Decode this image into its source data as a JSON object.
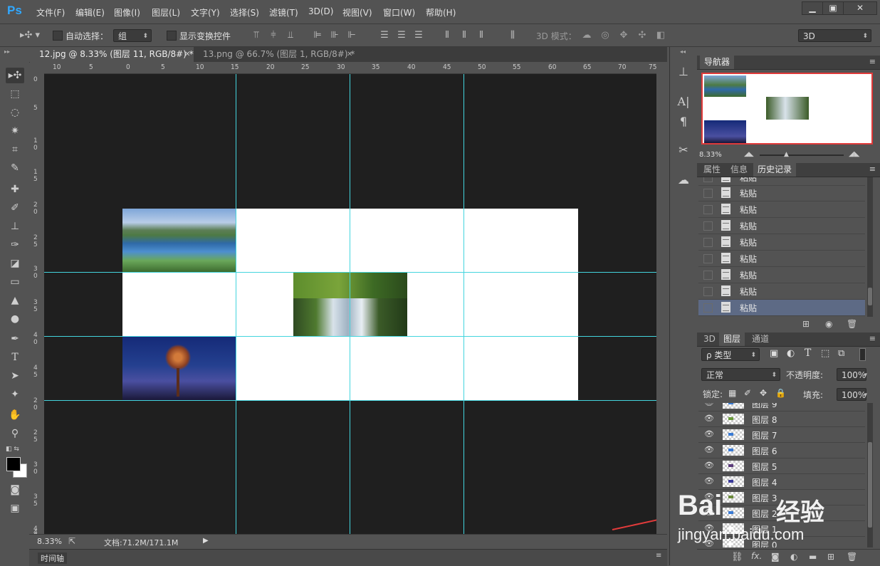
{
  "app": {
    "logo": "Ps"
  },
  "menu": [
    "文件(F)",
    "编辑(E)",
    "图像(I)",
    "图层(L)",
    "文字(Y)",
    "选择(S)",
    "滤镜(T)",
    "3D(D)",
    "视图(V)",
    "窗口(W)",
    "帮助(H)"
  ],
  "options": {
    "auto_select_label": "自动选择：",
    "auto_select_value": "组",
    "show_transform_label": "显示变换控件",
    "mode_3d_label": "3D 模式：",
    "workspace_value": "3D"
  },
  "tabs": [
    {
      "label": "12.jpg @ 8.33% (图层 11, RGB/8#) *",
      "active": true
    },
    {
      "label": "13.png @ 66.7% (图层 1, RGB/8#) *",
      "active": false
    }
  ],
  "ruler_top": [
    "10",
    "5",
    "0",
    "5",
    "10",
    "15",
    "20",
    "25",
    "30",
    "35",
    "40",
    "45",
    "50",
    "55",
    "60",
    "65",
    "70",
    "75"
  ],
  "ruler_left": [
    "0",
    "5",
    "1 0",
    "1 5",
    "2 0",
    "2 5",
    "3 0",
    "3 5",
    "4 0",
    "4 5",
    "2 0",
    "2 5",
    "3 0",
    "3 5",
    "4 0",
    "4"
  ],
  "status": {
    "zoom": "8.33%",
    "doc_info": "文档:71.2M/171.1M"
  },
  "timeline_label": "时间轴",
  "navigator": {
    "title": "导航器",
    "zoom": "8.33%"
  },
  "history_panel": {
    "tabs": [
      "属性",
      "信息",
      "历史记录"
    ],
    "active_tab": "历史记录",
    "items": [
      "粘贴",
      "粘贴",
      "粘贴",
      "粘贴",
      "粘贴",
      "粘贴",
      "粘贴",
      "粘贴",
      "粘贴"
    ]
  },
  "layers_panel": {
    "tabs": [
      "3D",
      "图层",
      "通道"
    ],
    "active_tab": "图层",
    "filter_label": "ρ 类型",
    "blend_mode": "正常",
    "opacity_label": "不透明度:",
    "opacity": "100%",
    "lock_label": "锁定:",
    "fill_label": "填充:",
    "fill": "100%",
    "layers": [
      "图层 9",
      "图层 8",
      "图层 7",
      "图层 6",
      "图层 5",
      "图层 4",
      "图层 3",
      "图层 2",
      "图层 1",
      "图层 0"
    ]
  },
  "watermark": {
    "brand": "Bai",
    "brand2": "经验",
    "url": "jingyan.baidu.com"
  },
  "colors": {
    "guide": "#43d5de",
    "canvas_bg": "#1f1f1f",
    "panel_bg": "#535353",
    "accent": "#31a8ff",
    "nav_frame": "#e03a3a"
  }
}
